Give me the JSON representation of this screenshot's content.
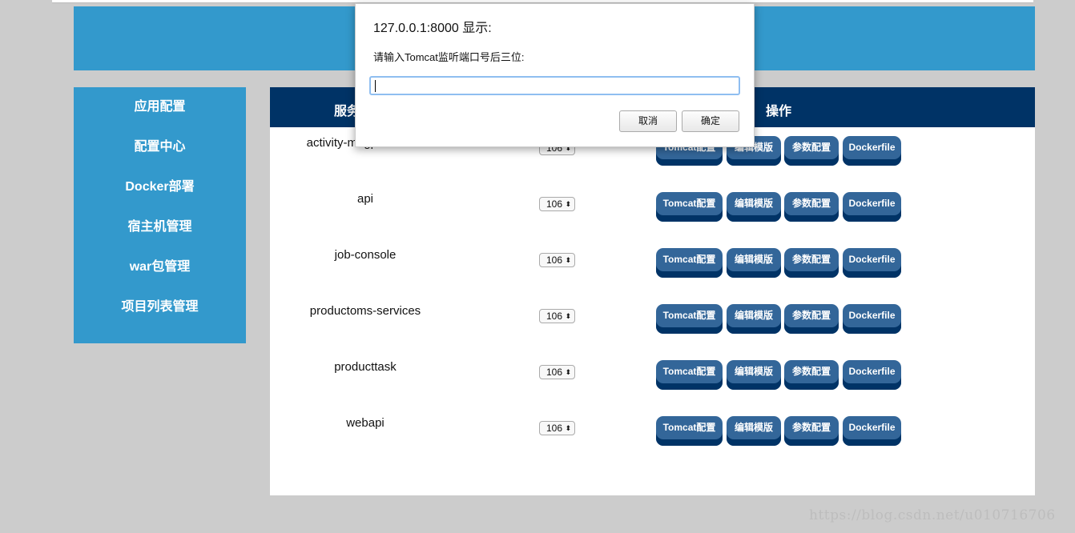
{
  "sidebar": {
    "items": [
      "应用配置",
      "配置中心",
      "Docker部署",
      "宿主机管理",
      "war包管理",
      "项目列表管理"
    ]
  },
  "table": {
    "headers": {
      "service": "服务",
      "actions": "操作"
    },
    "rows": [
      {
        "name": "activity-magpiefestival",
        "version": "106"
      },
      {
        "name": "api",
        "version": "106"
      },
      {
        "name": "job-console",
        "version": "106"
      },
      {
        "name": "productoms-services",
        "version": "106"
      },
      {
        "name": "producttask",
        "version": "106"
      },
      {
        "name": "webapi",
        "version": "106"
      }
    ],
    "buttons": [
      "Tomcat配置",
      "编辑模版",
      "参数配置",
      "Dockerfile"
    ]
  },
  "dialog": {
    "title": "127.0.0.1:8000 显示:",
    "message": "请输入Tomcat监听端口号后三位:",
    "input_value": "",
    "cancel": "取消",
    "ok": "确定"
  },
  "colors": {
    "banner": "#3399cc",
    "header": "#003366",
    "button": "#336699"
  },
  "watermark": "https://blog.csdn.net/u010716706"
}
